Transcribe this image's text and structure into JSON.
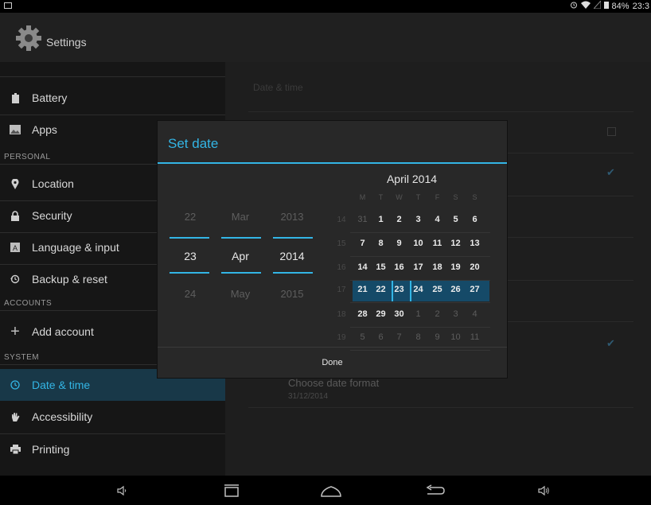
{
  "status_bar": {
    "battery_percent": "84%",
    "time": "23:3",
    "icons": [
      "notification-icon",
      "alarm-icon",
      "wifi-icon",
      "signal-icon",
      "battery-icon"
    ]
  },
  "action_bar": {
    "title": "Settings",
    "icon": "settings-gear-icon"
  },
  "sidebar": {
    "items": [
      {
        "label": "Battery",
        "icon": "battery-icon"
      },
      {
        "label": "Apps",
        "icon": "apps-icon"
      },
      {
        "label": "Location",
        "icon": "location-pin-icon"
      },
      {
        "label": "Security",
        "icon": "lock-icon"
      },
      {
        "label": "Language & input",
        "icon": "keyboard-icon"
      },
      {
        "label": "Backup & reset",
        "icon": "backup-icon"
      },
      {
        "label": "Add account",
        "icon": "plus-icon"
      },
      {
        "label": "Date & time",
        "icon": "clock-icon"
      },
      {
        "label": "Accessibility",
        "icon": "hand-icon"
      },
      {
        "label": "Printing",
        "icon": "printer-icon"
      }
    ],
    "headers": {
      "personal": "PERSONAL",
      "accounts": "ACCOUNTS",
      "system": "SYSTEM"
    },
    "active_item": "Date & time"
  },
  "right_pane": {
    "header": "Date & time",
    "date_format_title": "Choose date format",
    "date_format_value": "31/12/2014"
  },
  "dialog": {
    "title": "Set date",
    "picker": {
      "day": {
        "prev": "22",
        "selected": "23",
        "next": "24"
      },
      "month": {
        "prev": "Mar",
        "selected": "Apr",
        "next": "May"
      },
      "year": {
        "prev": "2013",
        "selected": "2014",
        "next": "2015"
      }
    },
    "calendar": {
      "month_label": "April 2014",
      "weekdays": [
        "M",
        "T",
        "W",
        "T",
        "F",
        "S",
        "S"
      ],
      "weeks": [
        {
          "num": "14",
          "days": [
            "31",
            "1",
            "2",
            "3",
            "4",
            "5",
            "6"
          ]
        },
        {
          "num": "15",
          "days": [
            "7",
            "8",
            "9",
            "10",
            "11",
            "12",
            "13"
          ]
        },
        {
          "num": "16",
          "days": [
            "14",
            "15",
            "16",
            "17",
            "18",
            "19",
            "20"
          ]
        },
        {
          "num": "17",
          "days": [
            "21",
            "22",
            "23",
            "24",
            "25",
            "26",
            "27"
          ]
        },
        {
          "num": "18",
          "days": [
            "28",
            "29",
            "30",
            "1",
            "2",
            "3",
            "4"
          ]
        },
        {
          "num": "19",
          "days": [
            "5",
            "6",
            "7",
            "8",
            "9",
            "10",
            "11"
          ]
        }
      ],
      "selected_day": "23",
      "colors": {
        "accent": "#33b5e5",
        "selected_week": "#154a68"
      }
    },
    "done_label": "Done"
  },
  "nav_bar": {
    "icons": [
      "volume-down-icon",
      "recent-apps-icon",
      "home-icon",
      "back-icon",
      "volume-up-icon"
    ]
  }
}
